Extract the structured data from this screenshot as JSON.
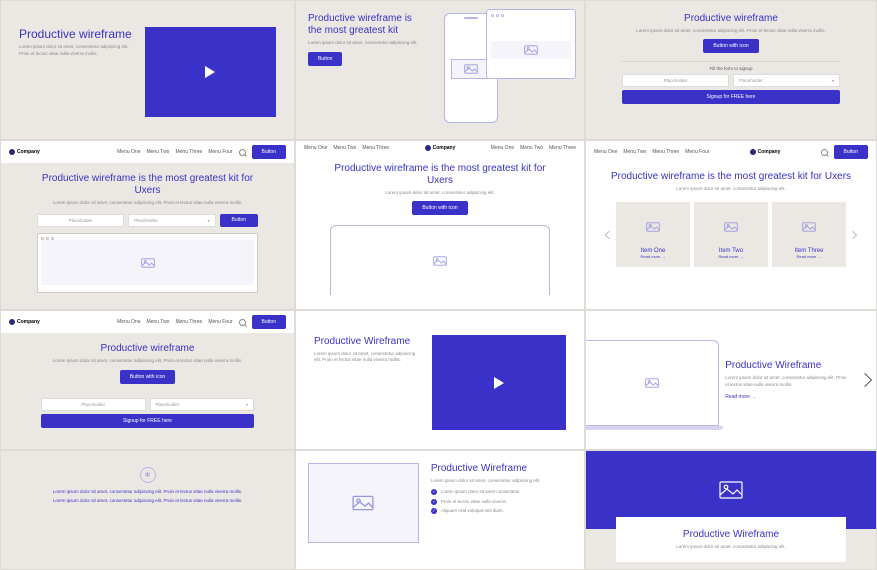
{
  "general": {
    "company": "Company",
    "menu": [
      "Menu One",
      "Menu Two",
      "Menu Three",
      "Menu Four"
    ],
    "button": "Button",
    "button_icon": "Button with icon",
    "lorem_short": "Lorem ipsum dolor sit amet, consectetur adipiscing elit.",
    "lorem_long": "Lorem ipsum dolor sit amet, consectetur adipiscing elit. Proin et lectus vitae nulla viverra mollis.",
    "placeholder": "Placeholder",
    "signup_cta": "Signup for FREE here",
    "fill_form": "Fill the form to signup",
    "read_more": "Read more →"
  },
  "a1": {
    "title": "Productive wireframe"
  },
  "a2": {
    "title": "Productive wireframe is the most greatest kit"
  },
  "a3": {
    "title": "Productive wireframe"
  },
  "b1": {
    "title": "Productive wireframe is the most greatest kit for Uxers"
  },
  "b2": {
    "title": "Productive wireframe is the most greatest kit for Uxers"
  },
  "b3": {
    "title": "Productive wireframe is the most greatest kit for Uxers",
    "cards": [
      "Item One",
      "Item Two",
      "Item Three"
    ]
  },
  "c1": {
    "title": "Productive wireframe"
  },
  "c2": {
    "title": "Productive Wireframe"
  },
  "c3": {
    "title": "Productive Wireframe"
  },
  "d2": {
    "title": "Productive Wireframe",
    "bullets": [
      "Lorem ipsum dolor sit amet consectetur.",
      "Proin et lectus vitae nulla viverra.",
      "Aliquam erat volutpat sed diam."
    ]
  },
  "d3": {
    "title": "Productive Wireframe"
  }
}
